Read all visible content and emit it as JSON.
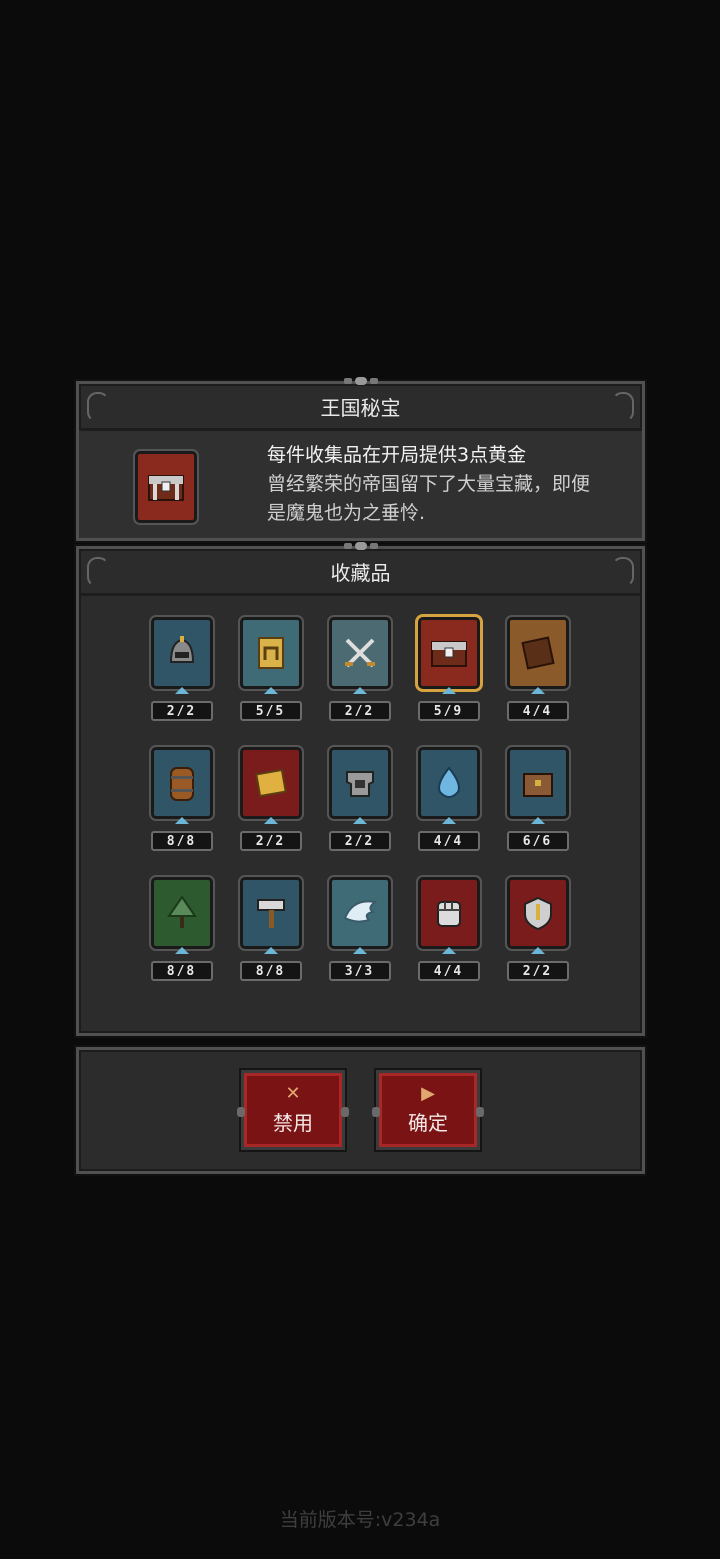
{
  "dialog": {
    "title": "王国秘宝",
    "selected_item": {
      "icon": "treasure-chest-icon",
      "desc_line1": "每件收集品在开局提供3点黄金",
      "desc_rest": "曾经繁荣的帝国留下了大量宝藏，即便是魔鬼也为之垂怜."
    }
  },
  "collection": {
    "title": "收藏品",
    "items": [
      {
        "icon": "helmet-icon",
        "count": "2/2",
        "bg": "#2f5566",
        "selected": false
      },
      {
        "icon": "scroll-card-icon",
        "count": "5/5",
        "bg": "#3e6b76",
        "selected": false
      },
      {
        "icon": "crossed-swords-icon",
        "count": "2/2",
        "bg": "#4b6a72",
        "selected": false
      },
      {
        "icon": "treasure-chest-icon",
        "count": "5/9",
        "bg": "#8a2a1e",
        "selected": true
      },
      {
        "icon": "book-icon",
        "count": "4/4",
        "bg": "#8a5a2a",
        "selected": false
      },
      {
        "icon": "barrel-icon",
        "count": "8/8",
        "bg": "#2f5566",
        "selected": false
      },
      {
        "icon": "spellbook-icon",
        "count": "2/2",
        "bg": "#7a1c1c",
        "selected": false
      },
      {
        "icon": "chest-armor-icon",
        "count": "2/2",
        "bg": "#2f5566",
        "selected": false
      },
      {
        "icon": "water-drop-icon",
        "count": "4/4",
        "bg": "#2f5566",
        "selected": false
      },
      {
        "icon": "treasure-box-icon",
        "count": "6/6",
        "bg": "#2f5566",
        "selected": false
      },
      {
        "icon": "tree-icon",
        "count": "8/8",
        "bg": "#2e5a30",
        "selected": false
      },
      {
        "icon": "hammer-icon",
        "count": "8/8",
        "bg": "#2f5566",
        "selected": false
      },
      {
        "icon": "wing-icon",
        "count": "3/3",
        "bg": "#3e6b76",
        "selected": false
      },
      {
        "icon": "fist-icon",
        "count": "4/4",
        "bg": "#7a1c1c",
        "selected": false
      },
      {
        "icon": "shield-icon",
        "count": "2/2",
        "bg": "#7a1c1c",
        "selected": false
      }
    ]
  },
  "buttons": {
    "disable_label": "禁用",
    "disable_glyph": "✕",
    "confirm_label": "确定",
    "confirm_glyph": "▶"
  },
  "footer": {
    "version": "当前版本号:v234a"
  }
}
